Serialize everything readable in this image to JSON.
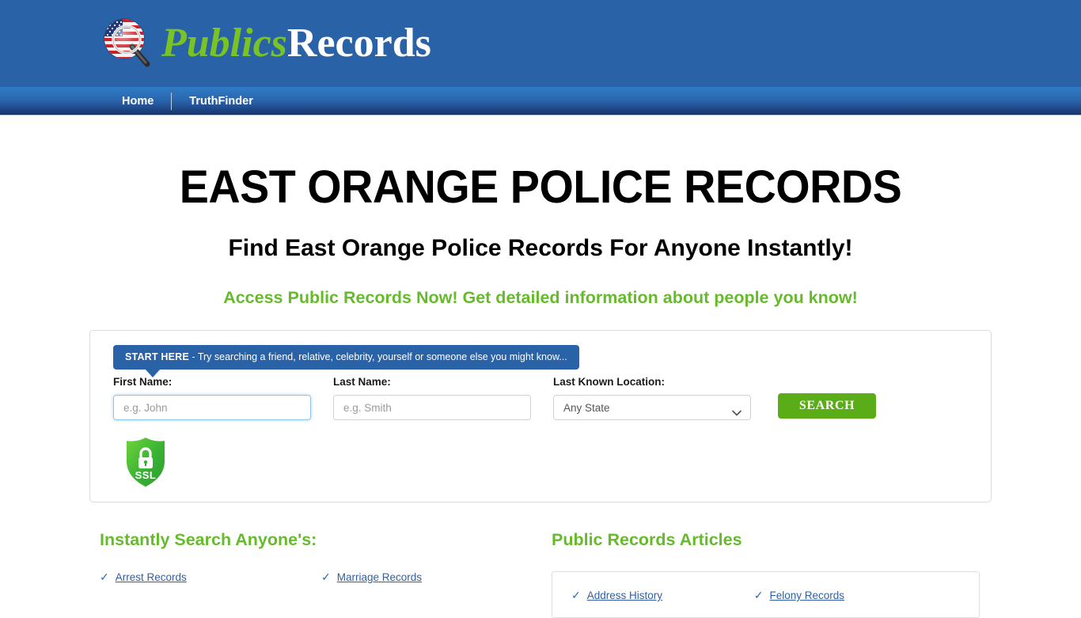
{
  "header": {
    "logo": {
      "icon": "flag-magnifier-icon",
      "text_green": "Publics",
      "text_white": "Records"
    }
  },
  "nav": {
    "items": [
      {
        "label": "Home",
        "name": "nav-item-home"
      },
      {
        "label": "TruthFinder",
        "name": "nav-item-truthfinder"
      }
    ]
  },
  "hero": {
    "title": "EAST ORANGE POLICE RECORDS",
    "subtitle": "Find East Orange Police Records For Anyone Instantly!",
    "tagline": "Access Public Records Now! Get detailed information about people you know!"
  },
  "search": {
    "callout_bold": "START HERE",
    "callout_rest": " - Try searching a friend, relative, celebrity, yourself or someone else you might know...",
    "first_name_label": "First Name:",
    "first_name_placeholder": "e.g. John",
    "first_name_value": "",
    "last_name_label": "Last Name:",
    "last_name_placeholder": "e.g. Smith",
    "last_name_value": "",
    "location_label": "Last Known Location:",
    "location_selected": "Any State",
    "location_options": [
      "Any State"
    ],
    "button_label": "SEARCH",
    "ssl_badge_label": "SSL",
    "caret_icon": "chevron-down-icon"
  },
  "left_column": {
    "heading": "Instantly Search Anyone's:",
    "links": [
      "Arrest Records",
      "Marriage Records"
    ]
  },
  "right_column": {
    "heading": "Public Records Articles",
    "links": [
      "Address History",
      "Felony Records"
    ]
  },
  "colors": {
    "header_blue": "#2a62a8",
    "nav_top": "#2e7cc6",
    "nav_bottom": "#16325f",
    "accent_green": "#66bb2a",
    "button_green": "#5aad16",
    "link_blue": "#2f5fa5"
  }
}
